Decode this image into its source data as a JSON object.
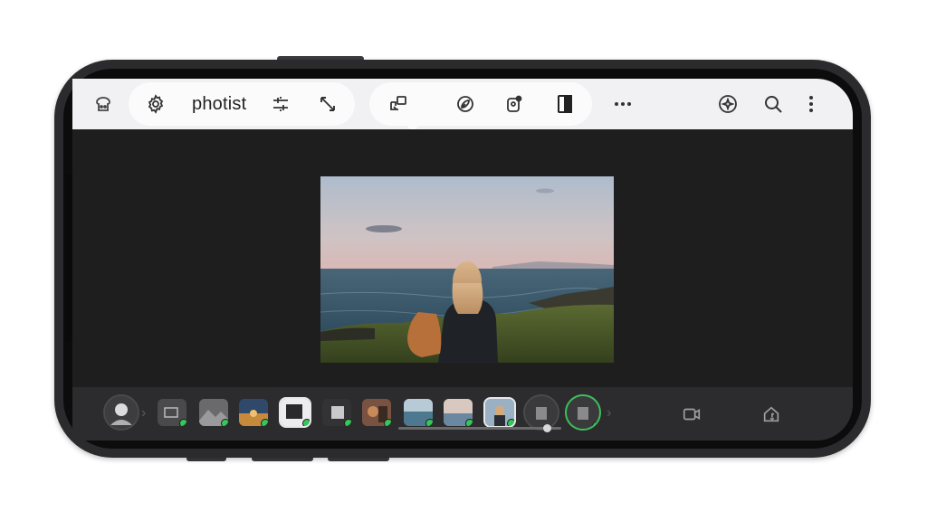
{
  "app": {
    "brand": "photist"
  },
  "toolbar": {
    "left": [
      {
        "icon": "toast-icon"
      },
      {
        "icon": "settings-gear-icon"
      }
    ],
    "crop_tools": [
      {
        "icon": "adjust-sliders-icon"
      },
      {
        "icon": "resize-arrow-icon"
      }
    ],
    "edit_tools": [
      {
        "icon": "layers-transform-icon"
      },
      {
        "icon": "leaf-filter-icon"
      },
      {
        "icon": "portrait-badge-icon"
      },
      {
        "icon": "compare-split-icon"
      },
      {
        "icon": "more-horizontal-icon"
      }
    ],
    "right": [
      {
        "icon": "enhance-sparkle-icon"
      },
      {
        "icon": "search-icon"
      },
      {
        "icon": "more-vertical-icon"
      }
    ]
  },
  "filmstrip": {
    "thumbnails": [
      {
        "name": "avatar",
        "selected": false,
        "done": true
      },
      {
        "name": "frame-1",
        "selected": false,
        "done": true
      },
      {
        "name": "frame-2",
        "selected": false,
        "done": true
      },
      {
        "name": "frame-3",
        "selected": false,
        "done": true
      },
      {
        "name": "frame-4",
        "selected": true,
        "done": true
      },
      {
        "name": "frame-5",
        "selected": false,
        "done": true
      },
      {
        "name": "frame-6",
        "selected": false,
        "done": true
      },
      {
        "name": "frame-7",
        "selected": false,
        "done": true
      },
      {
        "name": "frame-8",
        "selected": false,
        "done": true
      },
      {
        "name": "frame-9",
        "selected": false,
        "done": true
      },
      {
        "name": "frame-10",
        "selected": false,
        "done": false
      },
      {
        "name": "frame-11",
        "selected": false,
        "done": true
      }
    ],
    "actions": [
      {
        "icon": "video-camera-icon"
      },
      {
        "icon": "home-music-icon"
      }
    ]
  },
  "colors": {
    "toolbar_bg": "#f1f1f3",
    "canvas_bg": "#1e1e1f",
    "strip_bg": "#2c2c2e",
    "status_done": "#34c759"
  }
}
